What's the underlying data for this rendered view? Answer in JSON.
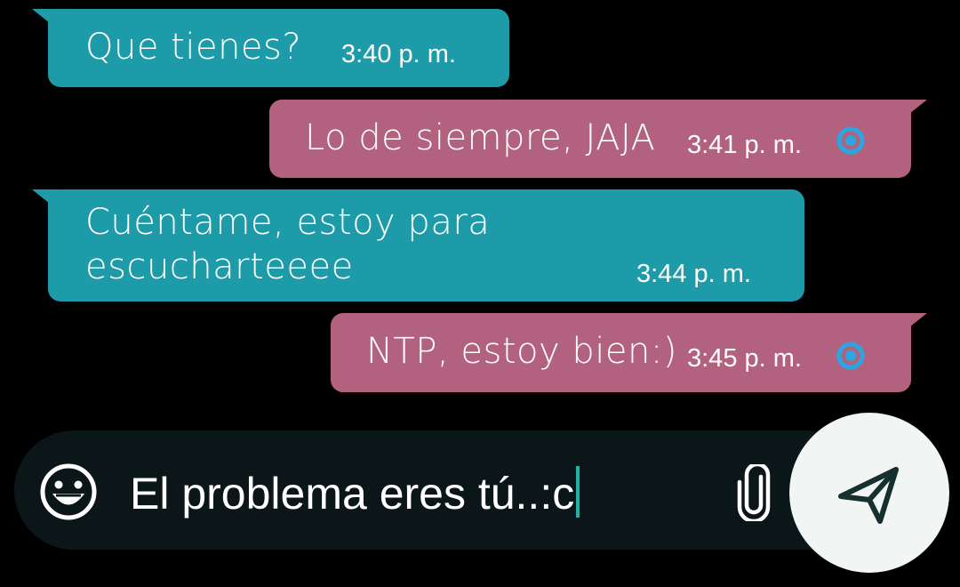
{
  "messages": [
    {
      "direction": "in",
      "text": "Que tienes?",
      "time": "3:40 p. m."
    },
    {
      "direction": "out",
      "text": "Lo de siempre, JAJA",
      "time": "3:41 p. m.",
      "status_icon": "read-receipt-icon"
    },
    {
      "direction": "in",
      "text": "Cuéntame, estoy para\nescucharteeee",
      "time": "3:44 p. m."
    },
    {
      "direction": "out",
      "text": "NTP, estoy bien:)",
      "time": "3:45 p. m.",
      "status_icon": "read-receipt-icon"
    }
  ],
  "composer": {
    "value": "El problema eres tú..:c",
    "emoji_icon": "emoji-icon",
    "attach_icon": "paperclip-icon",
    "send_icon": "send-icon"
  },
  "colors": {
    "background": "#000000",
    "incoming_bubble": "#1e9ba9",
    "outgoing_bubble": "#b2617f",
    "input_bar": "#0b1619",
    "send_button": "#f1f5f4",
    "read_receipt": "#2aa7e0",
    "caret": "#1fb3a6"
  }
}
